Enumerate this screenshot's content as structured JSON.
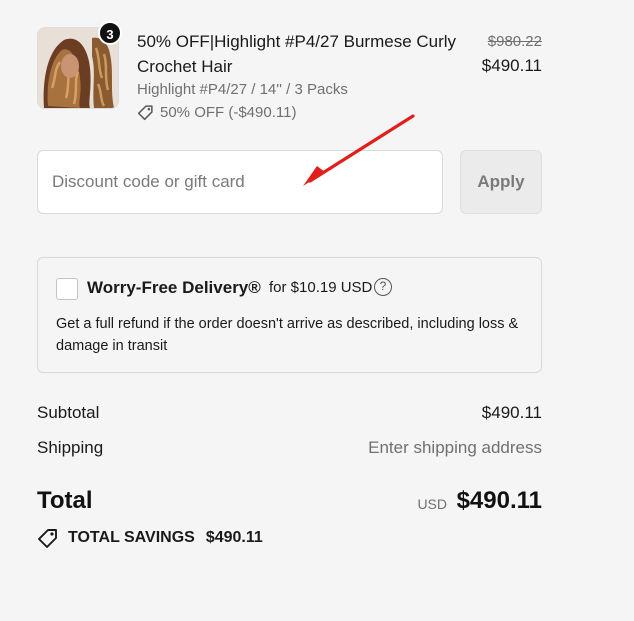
{
  "line_item": {
    "quantity": "3",
    "title": "50% OFF|Highlight #P4/27 Burmese Curly Crochet Hair",
    "variant": "Highlight #P4/27 / 14'' / 3 Packs",
    "discount": "50% OFF (-$490.11)",
    "original_price": "$980.22",
    "price": "$490.11",
    "icon": "tag-icon"
  },
  "discount_field": {
    "placeholder": "Discount code or gift card",
    "value": "",
    "apply_label": "Apply"
  },
  "shipping_protection": {
    "title": "Worry-Free Delivery®",
    "price": "for $10.19 USD",
    "help": "?",
    "description": "Get a full refund if the order doesn't arrive as described, including loss & damage in transit",
    "checked": false
  },
  "summary": {
    "subtotal_label": "Subtotal",
    "subtotal_value": "$490.11",
    "shipping_label": "Shipping",
    "shipping_value": "Enter shipping address",
    "total_label": "Total",
    "currency": "USD",
    "total_value": "$490.11",
    "savings_label": "TOTAL SAVINGS",
    "savings_value": "$490.11"
  },
  "colors": {
    "background": "#f5f5f5",
    "annotation_arrow": "#e0201b"
  }
}
